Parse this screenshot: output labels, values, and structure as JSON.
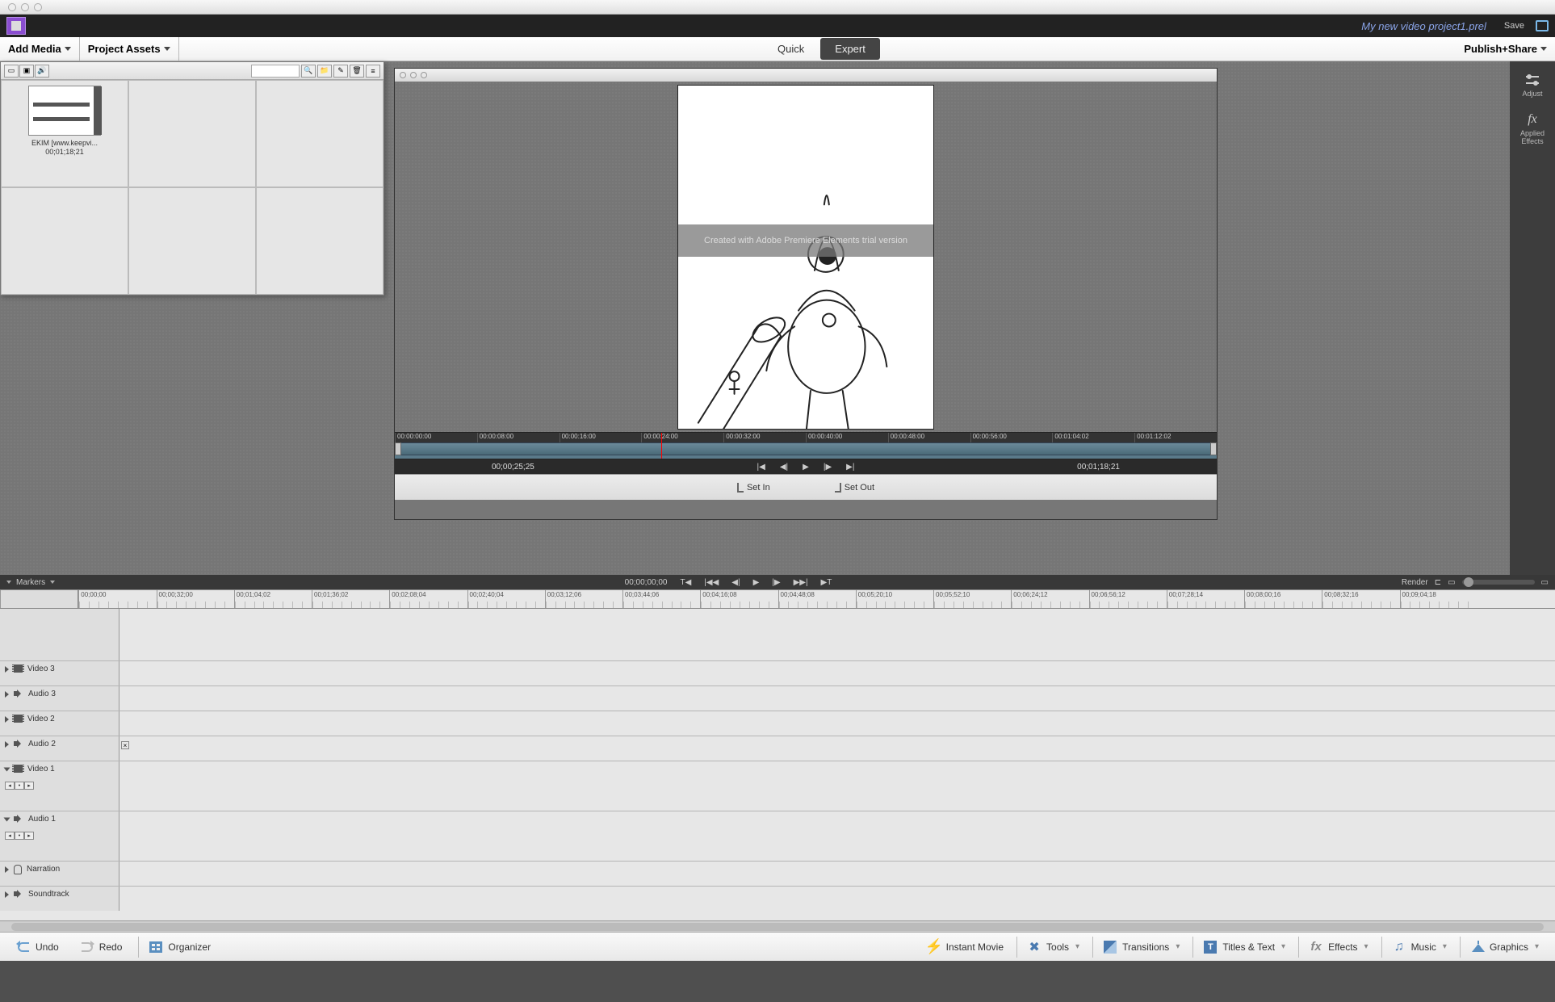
{
  "topbar": {
    "project_name": "My new video project1.prel",
    "save_label": "Save"
  },
  "secondbar": {
    "add_media": "Add Media",
    "project_assets": "Project Assets",
    "tab_quick": "Quick",
    "tab_expert": "Expert",
    "publish_share": "Publish+Share"
  },
  "assets": {
    "clip1_name": "EKIM [www.keepvi...",
    "clip1_duration": "00;01;18;21"
  },
  "right_tools": {
    "adjust": "Adjust",
    "applied_effects": "Applied\nEffects"
  },
  "preview": {
    "watermark": "Created with Adobe Premiere Elements trial version",
    "mini_ticks": [
      "00:00:00:00",
      "00:00:08:00",
      "00:00:16:00",
      "00:00:24:00",
      "00:00:32:00",
      "00:00:40:00",
      "00:00:48:00",
      "00:00:56:00",
      "00:01:04:02",
      "00:01:12:02"
    ],
    "current_tc": "00;00;25;25",
    "duration_tc": "00;01;18;21",
    "set_in": "Set In",
    "set_out": "Set Out"
  },
  "tl_header": {
    "markers": "Markers",
    "timecode": "00;00;00;00",
    "render": "Render"
  },
  "tl_ruler": [
    "00;00;00",
    "00;00;32;00",
    "00;01;04;02",
    "00;01;36;02",
    "00;02;08;04",
    "00;02;40;04",
    "00;03;12;06",
    "00;03;44;06",
    "00;04;16;08",
    "00;04;48;08",
    "00;05;20;10",
    "00;05;52;10",
    "00;06;24;12",
    "00;06;56;12",
    "00;07;28;14",
    "00;08;00;16",
    "00;08;32;16",
    "00;09;04;18"
  ],
  "tracks": {
    "video3": "Video 3",
    "audio3": "Audio 3",
    "video2": "Video 2",
    "audio2": "Audio 2",
    "video1": "Video 1",
    "audio1": "Audio 1",
    "narration": "Narration",
    "soundtrack": "Soundtrack"
  },
  "bottombar": {
    "undo": "Undo",
    "redo": "Redo",
    "organizer": "Organizer",
    "instantmovie": "Instant Movie",
    "tools": "Tools",
    "transitions": "Transitions",
    "titles": "Titles & Text",
    "effects": "Effects",
    "music": "Music",
    "graphics": "Graphics"
  }
}
